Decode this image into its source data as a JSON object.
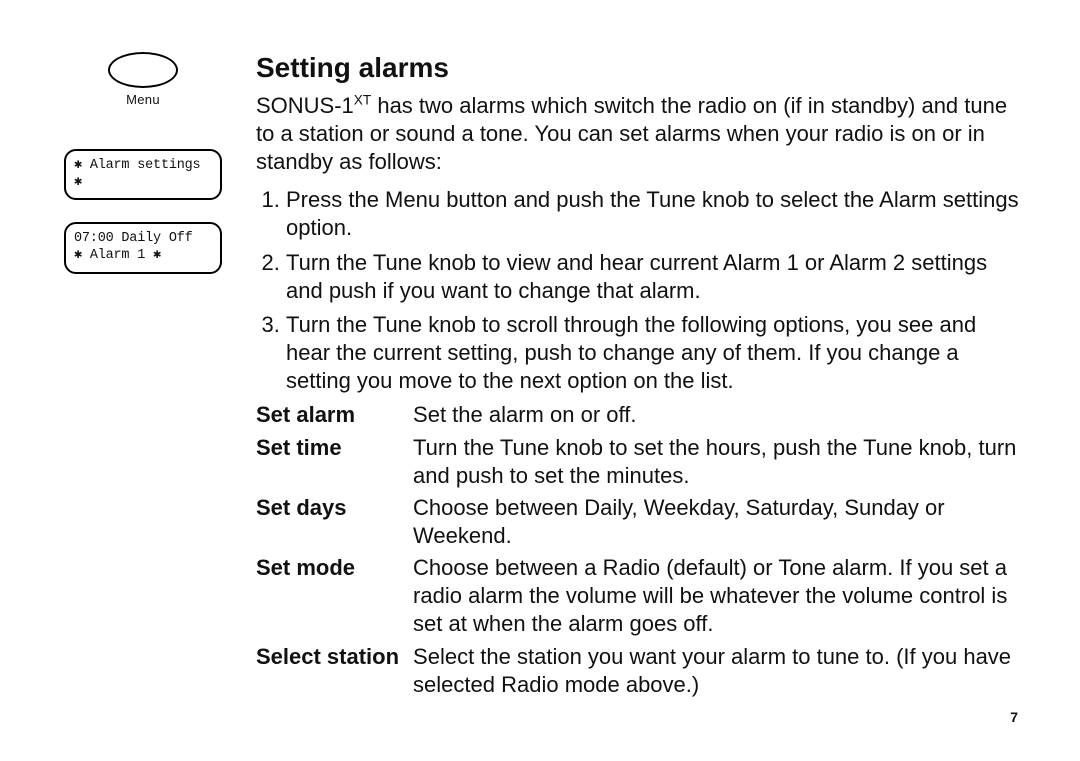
{
  "sidebar": {
    "menu_label": "Menu",
    "lcd1_line": "✱ Alarm settings ✱",
    "lcd2_line1": "  07:00 Daily Off",
    "lcd2_line2": "✱ Alarm 1          ✱"
  },
  "heading": "Setting alarms",
  "intro_prefix": "SONUS-1",
  "intro_sup": "XT",
  "intro_rest": " has two alarms which switch the radio on (if in standby) and tune to a station or sound a tone. You can set alarms when your radio is on or in standby as follows:",
  "steps": [
    "Press the Menu button and push the Tune knob to select the Alarm settings option.",
    "Turn the Tune knob to view and hear current Alarm 1 or Alarm 2 settings and push if you want to change that alarm.",
    "Turn the Tune knob to scroll through the following options, you see and hear the current setting, push to change any of them. If you change a setting you move to the next option on the list."
  ],
  "defs": [
    {
      "term": "Set alarm",
      "desc": "Set the alarm on or off."
    },
    {
      "term": "Set time",
      "desc": "Turn the Tune knob to set the hours, push the Tune knob, turn and push to set the minutes."
    },
    {
      "term": "Set days",
      "desc": "Choose between Daily, Weekday, Saturday, Sunday or Weekend."
    },
    {
      "term": "Set mode",
      "desc": "Choose between a Radio (default) or Tone alarm. If you set a radio alarm the volume will be whatever the volume control is set at when the alarm goes off."
    },
    {
      "term": "Select station",
      "desc": "Select the station you want your alarm to tune to. (If you have selected Radio mode above.)"
    }
  ],
  "page_number": "7"
}
